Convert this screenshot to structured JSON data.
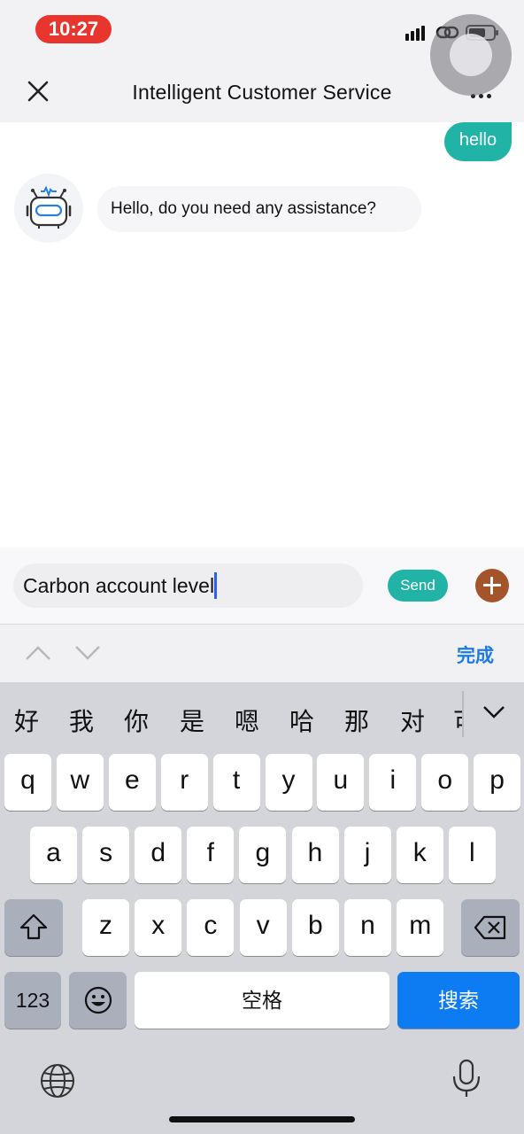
{
  "status_bar": {
    "time": "10:27"
  },
  "header": {
    "title": "Intelligent Customer Service"
  },
  "chat": {
    "messages": [
      {
        "sender": "user",
        "text": "hello"
      },
      {
        "sender": "bot",
        "text": "Hello, do you need any assistance?"
      }
    ]
  },
  "composer": {
    "input_value": "Carbon account level",
    "send_label": "Send"
  },
  "accessory_bar": {
    "done_label": "完成"
  },
  "keyboard": {
    "candidates": [
      "好",
      "我",
      "你",
      "是",
      "嗯",
      "哈",
      "那",
      "对",
      "可"
    ],
    "row1": [
      "q",
      "w",
      "e",
      "r",
      "t",
      "y",
      "u",
      "i",
      "o",
      "p"
    ],
    "row2": [
      "a",
      "s",
      "d",
      "f",
      "g",
      "h",
      "j",
      "k",
      "l"
    ],
    "row3": [
      "z",
      "x",
      "c",
      "v",
      "b",
      "n",
      "m"
    ],
    "numbers_label": "123",
    "space_label": "空格",
    "search_label": "搜索"
  },
  "icons": {
    "close": "close-icon",
    "more": "more-icon",
    "robot": "robot-avatar-icon",
    "plus": "plus-icon",
    "shift": "shift-icon",
    "backspace": "backspace-icon",
    "emoji": "emoji-icon",
    "globe": "globe-icon",
    "mic": "mic-icon"
  },
  "colors": {
    "accent_teal": "#20b3a6",
    "plus_brown": "#a3542a",
    "time_red": "#e8362f",
    "search_blue": "#0d7cf2",
    "done_blue": "#1e7be6"
  }
}
